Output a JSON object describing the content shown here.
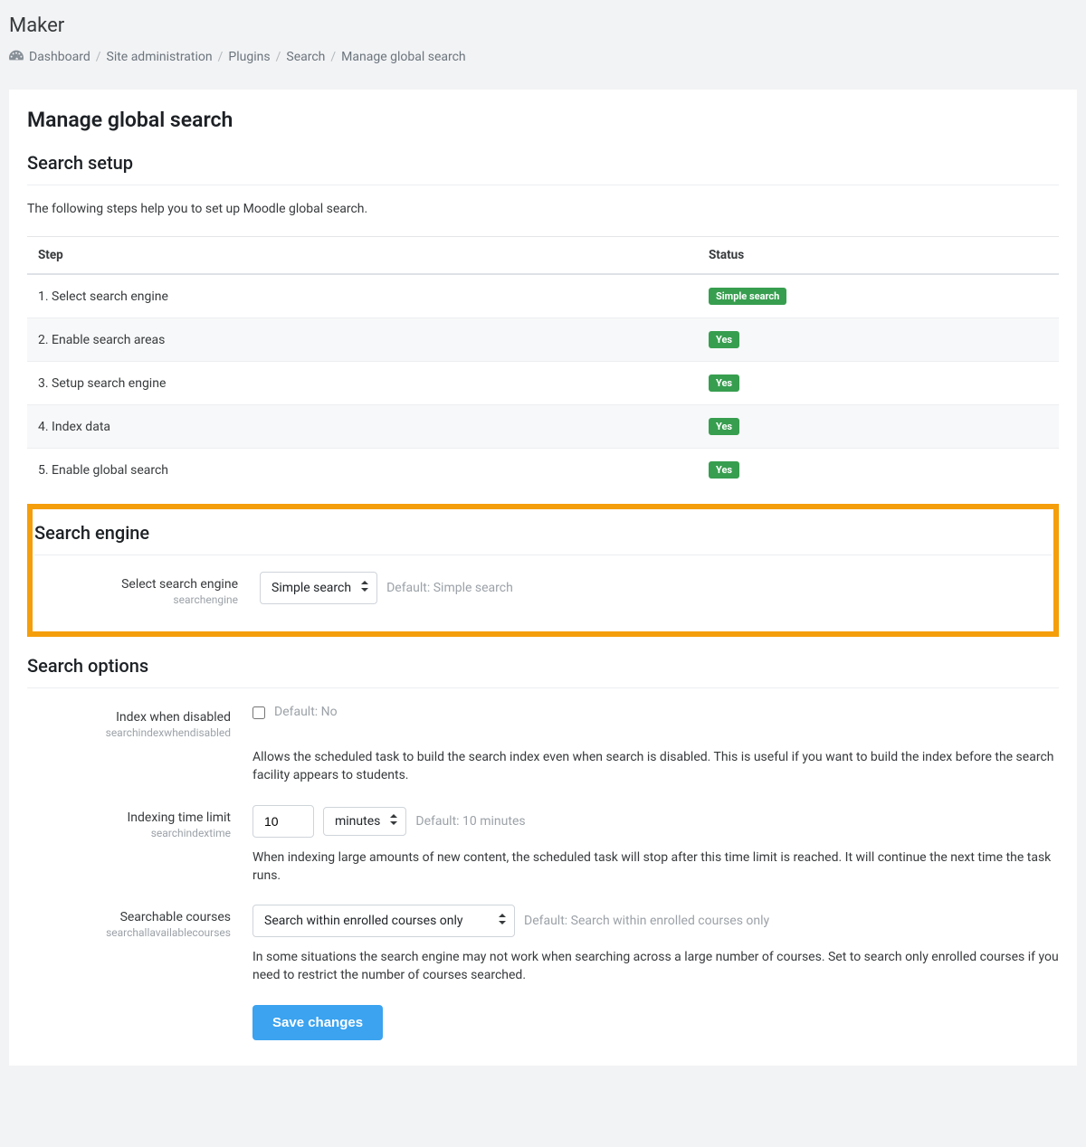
{
  "site_title": "Maker",
  "breadcrumb": {
    "items": [
      "Dashboard",
      "Site administration",
      "Plugins",
      "Search",
      "Manage global search"
    ]
  },
  "page_title": "Manage global search",
  "search_setup": {
    "heading": "Search setup",
    "intro": "The following steps help you to set up Moodle global search.",
    "table": {
      "header_step": "Step",
      "header_status": "Status",
      "rows": [
        {
          "step": "1. Select search engine",
          "status": "Simple search"
        },
        {
          "step": "2. Enable search areas",
          "status": "Yes"
        },
        {
          "step": "3. Setup search engine",
          "status": "Yes"
        },
        {
          "step": "4. Index data",
          "status": "Yes"
        },
        {
          "step": "5. Enable global search",
          "status": "Yes"
        }
      ]
    }
  },
  "search_engine": {
    "heading": "Search engine",
    "label": "Select search engine",
    "id": "searchengine",
    "value": "Simple search",
    "default_text": "Default: Simple search"
  },
  "search_options": {
    "heading": "Search options",
    "index_disabled": {
      "label": "Index when disabled",
      "id": "searchindexwhendisabled",
      "default_text": "Default: No",
      "help": "Allows the scheduled task to build the search index even when search is disabled. This is useful if you want to build the index before the search facility appears to students."
    },
    "time_limit": {
      "label": "Indexing time limit",
      "id": "searchindextime",
      "value": "10",
      "unit": "minutes",
      "default_text": "Default: 10 minutes",
      "help": "When indexing large amounts of new content, the scheduled task will stop after this time limit is reached. It will continue the next time the task runs."
    },
    "searchable_courses": {
      "label": "Searchable courses",
      "id": "searchallavailablecourses",
      "value": "Search within enrolled courses only",
      "default_text": "Default: Search within enrolled courses only",
      "help": "In some situations the search engine may not work when searching across a large number of courses. Set to search only enrolled courses if you need to restrict the number of courses searched."
    },
    "save_button": "Save changes"
  }
}
